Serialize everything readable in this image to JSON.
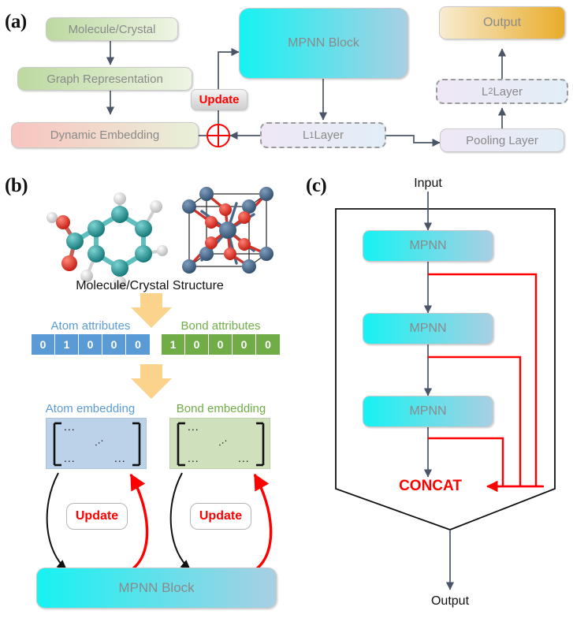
{
  "figure": {
    "panels": [
      {
        "id": "a",
        "label": "(a)"
      },
      {
        "id": "b",
        "label": "(b)"
      },
      {
        "id": "c",
        "label": "(c)"
      }
    ]
  },
  "panel_a": {
    "label": "(a)",
    "boxes": {
      "molecule_crystal": "Molecule/Crystal",
      "graph_representation": "Graph Representation",
      "dynamic_embedding": "Dynamic Embedding",
      "mpnn_block": "MPNN Block",
      "update": "Update",
      "l1_layer_base": "L",
      "l1_layer_sub": "1",
      "l1_layer_rest": " Layer",
      "l2_layer_base": "L",
      "l2_layer_sub": "2",
      "l2_layer_rest": " Layer",
      "pooling_layer": "Pooling Layer",
      "output": "Output"
    },
    "operator": "plus-circle"
  },
  "panel_b": {
    "label": "(b)",
    "structure_caption": "Molecule/Crystal Structure",
    "atom_attributes_label": "Atom attributes",
    "bond_attributes_label": "Bond attributes",
    "atom_attributes": [
      "0",
      "1",
      "0",
      "0",
      "0"
    ],
    "bond_attributes": [
      "1",
      "0",
      "0",
      "0",
      "0"
    ],
    "atom_embedding_label": "Atom embedding",
    "bond_embedding_label": "Bond embedding",
    "matrix_dots": "...",
    "update_left": "Update",
    "update_right": "Update",
    "mpnn_block": "MPNN Block"
  },
  "panel_c": {
    "label": "(c)",
    "input": "Input",
    "output": "Output",
    "blocks": [
      "MPNN",
      "MPNN",
      "MPNN"
    ],
    "concat": "CONCAT"
  },
  "colors": {
    "green_box_start": "#bcd9a0",
    "green_box_end": "#eef5e4",
    "pink_box_start": "#f8c4c0",
    "pink_box_end": "#e9f0d8",
    "cyan_start": "#17f2f2",
    "cyan_end": "#a9cfe3",
    "lavender_start": "#efe7f5",
    "lavender_end": "#e2eef7",
    "output_start": "#f8ecd2",
    "output_end": "#e8ac2a",
    "atom_blue": "#5b9bd5",
    "bond_green": "#70ad47",
    "arrow_navy": "#4a5568",
    "red": "#ff0000",
    "arrow_yellow": "#fbd38d",
    "atom_embed_bg": "#bcd2e8",
    "bond_embed_bg": "#cfe0bd",
    "carbon": "#1f8f8f",
    "oxygen": "#e02b20",
    "hydrogen": "#e8e8e8",
    "crystal_blue": "#46688c",
    "crystal_red": "#e02b20"
  }
}
